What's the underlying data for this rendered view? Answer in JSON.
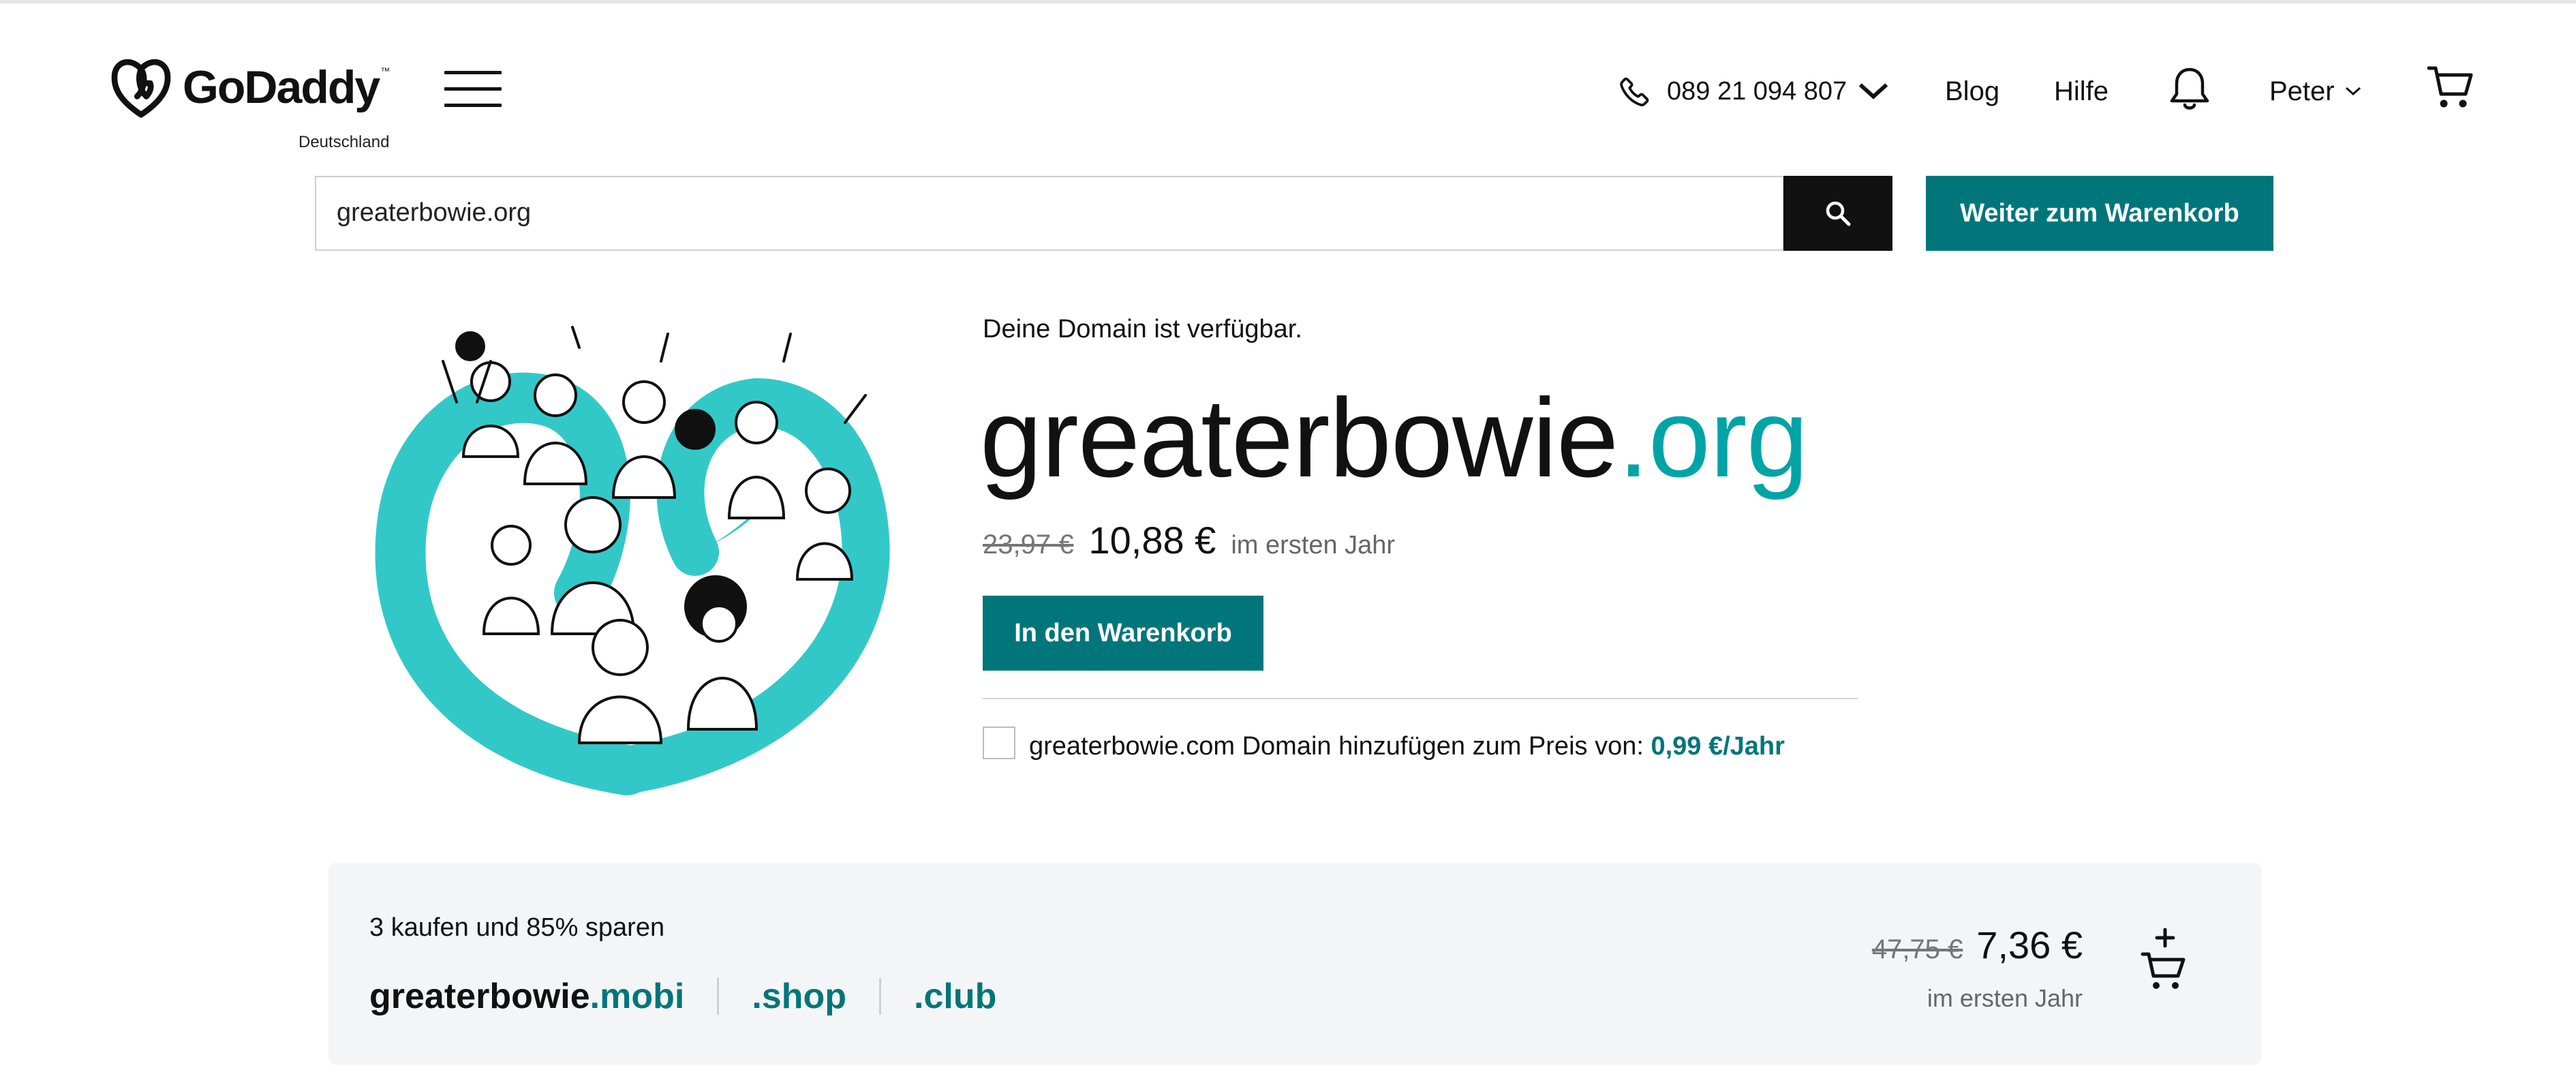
{
  "colors": {
    "accent": "#00767a",
    "tld_highlight": "#00a4a6",
    "illustration": "#33c8c8",
    "dark_button": "#111111",
    "bundle_bg": "#f4f5f6"
  },
  "header": {
    "logo_text": "GoDaddy",
    "logo_trademark": "™",
    "region": "Deutschland",
    "menu_icon": "hamburger-menu-icon",
    "phone": "089 21 094 807",
    "nav": {
      "blog": "Blog",
      "help": "Hilfe"
    },
    "notifications_icon": "bell-icon",
    "user_name": "Peter",
    "cart_icon": "cart-icon"
  },
  "search": {
    "value": "greaterbowie.org",
    "button_icon": "search-icon",
    "checkout_label": "Weiter zum Warenkorb"
  },
  "result": {
    "availability": "Deine Domain ist verfügbar.",
    "domain_name": "greaterbowie",
    "domain_tld": ".org",
    "old_price": "23,97 €",
    "price": "10,88 €",
    "price_note": "im ersten Jahr",
    "add_to_cart": "In den Warenkorb",
    "addon_text": "greaterbowie.com Domain hinzufügen zum Preis von:",
    "addon_price": "0,99 €/Jahr"
  },
  "bundle": {
    "title": "3 kaufen und 85% sparen",
    "domain_name": "greaterbowie",
    "tlds": [
      ".mobi",
      ".shop",
      ".club"
    ],
    "old_price": "47,75 €",
    "price": "7,36 €",
    "price_note": "im ersten Jahr",
    "cart_icon": "add-to-cart-icon"
  }
}
